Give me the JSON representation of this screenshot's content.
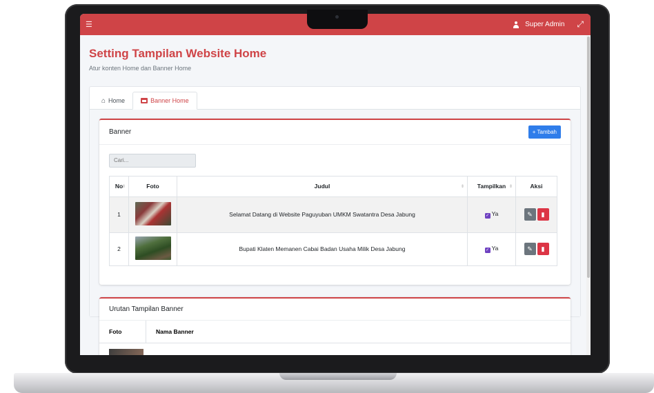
{
  "topbar": {
    "user_name": "Super Admin"
  },
  "page": {
    "title": "Setting Tampilan Website Home",
    "subtitle": "Atur konten Home dan Banner Home"
  },
  "tabs": [
    {
      "label": "Home",
      "active": false
    },
    {
      "label": "Banner Home",
      "active": true
    }
  ],
  "banner_card": {
    "title": "Banner",
    "add_label": "+ Tambah",
    "search_placeholder": "Cari...",
    "columns": [
      "No",
      "Foto",
      "Judul",
      "Tampilkan",
      "Aksi"
    ],
    "rows": [
      {
        "no": "1",
        "judul": "Selamat Datang di Website Paguyuban UMKM Swatantra Desa Jabung",
        "tampilkan": "Ya"
      },
      {
        "no": "2",
        "judul": "Bupati Klaten Memanen Cabai Badan Usaha Milik Desa Jabung",
        "tampilkan": "Ya"
      }
    ]
  },
  "order_card": {
    "title": "Urutan Tampilan Banner",
    "columns": [
      "Foto",
      "Nama Banner"
    ]
  },
  "colors": {
    "accent": "#cf4447",
    "primary": "#2f7dea",
    "danger": "#dc3545",
    "check": "#6f42c1"
  }
}
